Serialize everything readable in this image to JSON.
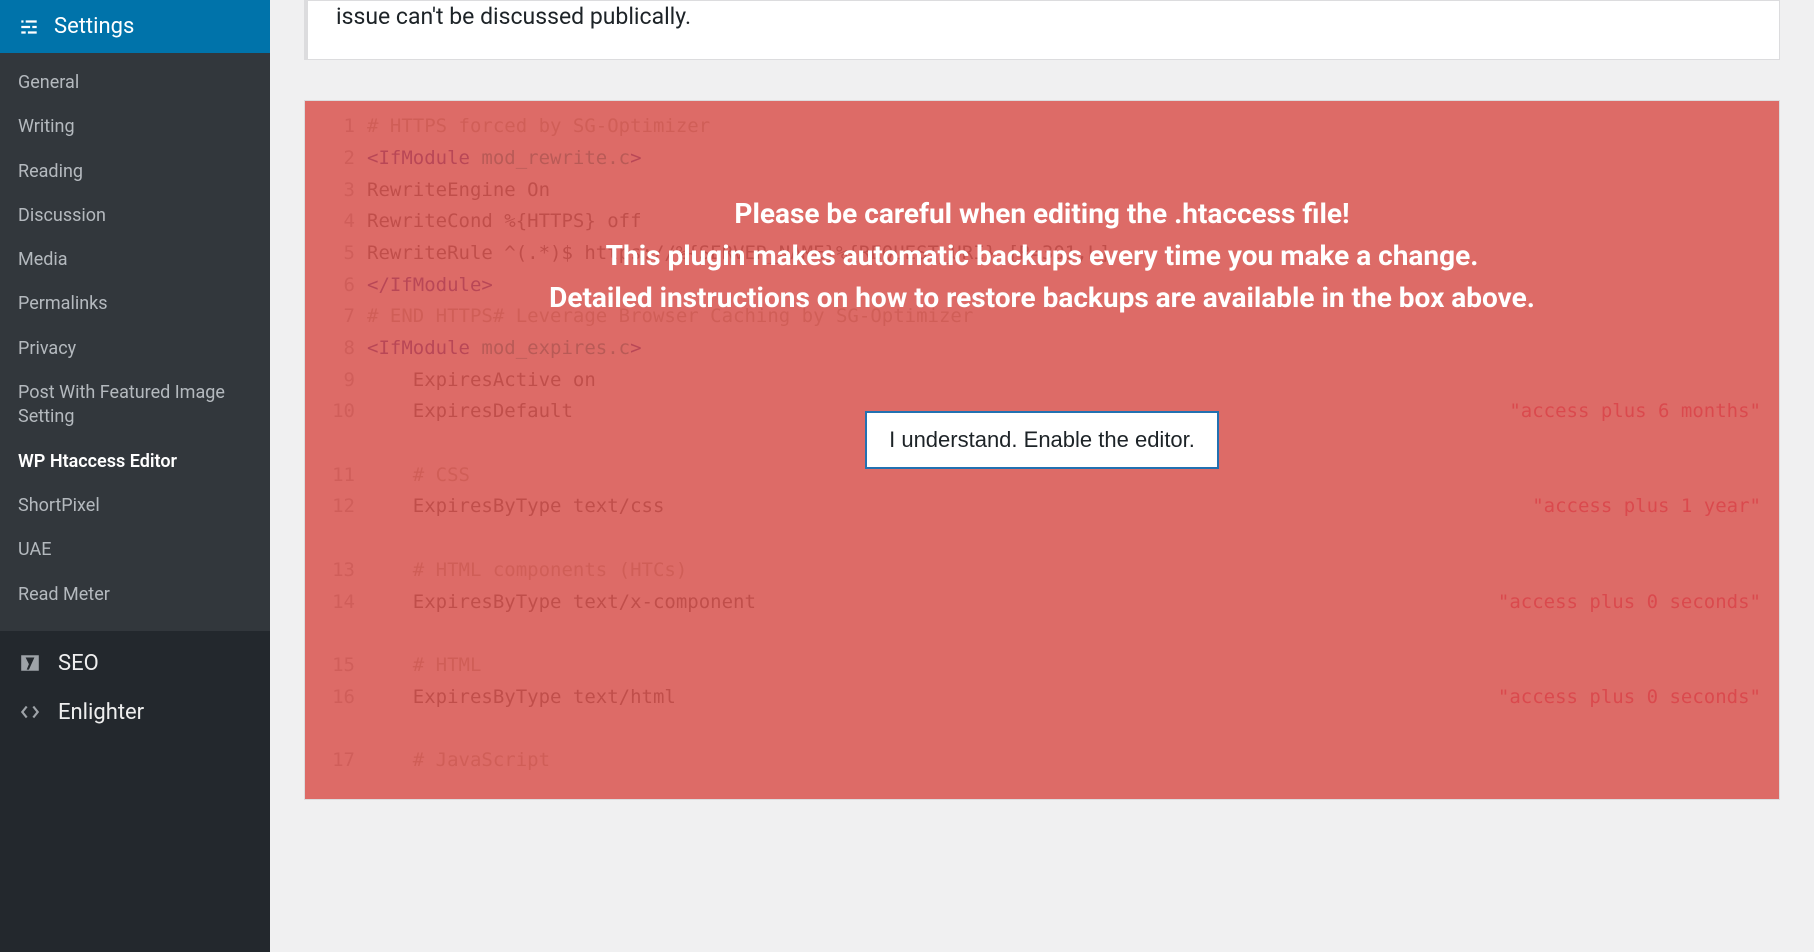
{
  "sidebar": {
    "header_label": "Settings",
    "submenu": [
      {
        "label": "General",
        "active": false
      },
      {
        "label": "Writing",
        "active": false
      },
      {
        "label": "Reading",
        "active": false
      },
      {
        "label": "Discussion",
        "active": false
      },
      {
        "label": "Media",
        "active": false
      },
      {
        "label": "Permalinks",
        "active": false
      },
      {
        "label": "Privacy",
        "active": false
      },
      {
        "label": "Post With Featured Image Setting",
        "active": false
      },
      {
        "label": "WP Htaccess Editor",
        "active": true
      },
      {
        "label": "ShortPixel",
        "active": false
      },
      {
        "label": "UAE",
        "active": false
      },
      {
        "label": "Read Meter",
        "active": false
      }
    ],
    "bottom": [
      {
        "label": "SEO",
        "icon": "yoast"
      },
      {
        "label": "Enlighter",
        "icon": "code"
      }
    ]
  },
  "notice": {
    "text": "issue can't be discussed publically."
  },
  "overlay": {
    "line1": "Please be careful when editing the .htaccess file!",
    "line2": "This plugin makes automatic backups every time you make a change.",
    "line3": "Detailed instructions on how to restore backups are available in the box above.",
    "button": "I understand. Enable the editor."
  },
  "code": {
    "lines": [
      {
        "n": 1,
        "type": "comment",
        "text": "# HTTPS forced by SG-Optimizer"
      },
      {
        "n": 2,
        "type": "tag",
        "tag": "IfModule",
        "attr": "mod_rewrite.c"
      },
      {
        "n": 3,
        "type": "plain",
        "text": "RewriteEngine On"
      },
      {
        "n": 4,
        "type": "plain",
        "text": "RewriteCond %{HTTPS} off"
      },
      {
        "n": 5,
        "type": "plain",
        "text": "RewriteRule ^(.*)$ https://%{SERVER_NAME}%{REQUEST_URI} [R=301,L]"
      },
      {
        "n": 6,
        "type": "tagclose",
        "tag": "IfModule"
      },
      {
        "n": 7,
        "type": "comment",
        "text": "# END HTTPS# Leverage Browser Caching by SG-Optimizer"
      },
      {
        "n": 8,
        "type": "tag",
        "tag": "IfModule",
        "attr": "mod_expires.c"
      },
      {
        "n": 9,
        "type": "plain",
        "text": "    ExpiresActive on"
      },
      {
        "n": 10,
        "type": "kv",
        "key": "    ExpiresDefault",
        "val": "\"access plus 6 months\""
      },
      {
        "n": 11,
        "type": "comment",
        "text": "    # CSS"
      },
      {
        "n": 12,
        "type": "kv",
        "key": "    ExpiresByType text/css",
        "val": "\"access plus 1 year\""
      },
      {
        "n": 13,
        "type": "comment",
        "text": "    # HTML components (HTCs)"
      },
      {
        "n": 14,
        "type": "kv",
        "key": "    ExpiresByType text/x-component",
        "val": "\"access plus 0 seconds\""
      },
      {
        "n": 15,
        "type": "comment",
        "text": "    # HTML"
      },
      {
        "n": 16,
        "type": "kv",
        "key": "    ExpiresByType text/html",
        "val": "\"access plus 0 seconds\""
      },
      {
        "n": 17,
        "type": "comment",
        "text": "    # JavaScript"
      }
    ]
  }
}
